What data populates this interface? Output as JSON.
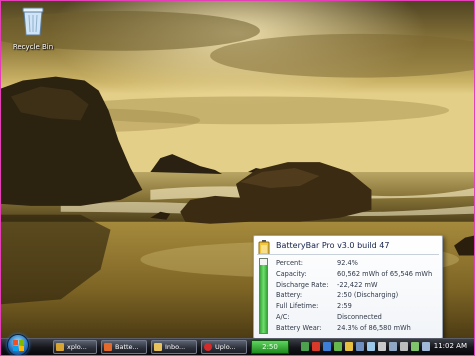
{
  "desktop": {
    "icons": [
      {
        "label": "Recycle Bin",
        "icon": "recycle-bin-icon"
      }
    ]
  },
  "battery_popup": {
    "title": "BatteryBar Pro v3.0 build 47",
    "charge_level": 0.924,
    "rows": [
      {
        "label": "Percent:",
        "value": "92.4%"
      },
      {
        "label": "Capacity:",
        "value": "60,562 mWh of 65,546 mWh"
      },
      {
        "label": "Discharge Rate:",
        "value": "-22,422 mW"
      },
      {
        "label": "Battery:",
        "value": "2:50 (Discharging)"
      },
      {
        "label": "Full Lifetime:",
        "value": "2:59"
      },
      {
        "label": "A/C:",
        "value": "Disconnected"
      },
      {
        "label": "Battery Wear:",
        "value": "24.3% of 86,580 mWh"
      }
    ]
  },
  "taskbar": {
    "start_icon": "windows-logo-icon",
    "tasks": [
      {
        "label": "xplo...",
        "icon": "explorer-icon",
        "color": "#d9a531"
      },
      {
        "label": "Batte...",
        "icon": "paint-icon",
        "color": "#e46a2b"
      },
      {
        "label": "Inbo...",
        "icon": "folder-icon",
        "color": "#e9c25c"
      },
      {
        "label": "Uplo...",
        "icon": "opera-icon",
        "color": "#d42a2a"
      }
    ],
    "battery_bar_text": "2:50",
    "clock": "11:02 AM"
  },
  "colors": {
    "battery_green": "#2fa52f",
    "frame_border": "#e53fb8",
    "taskbar": "#15161b"
  }
}
